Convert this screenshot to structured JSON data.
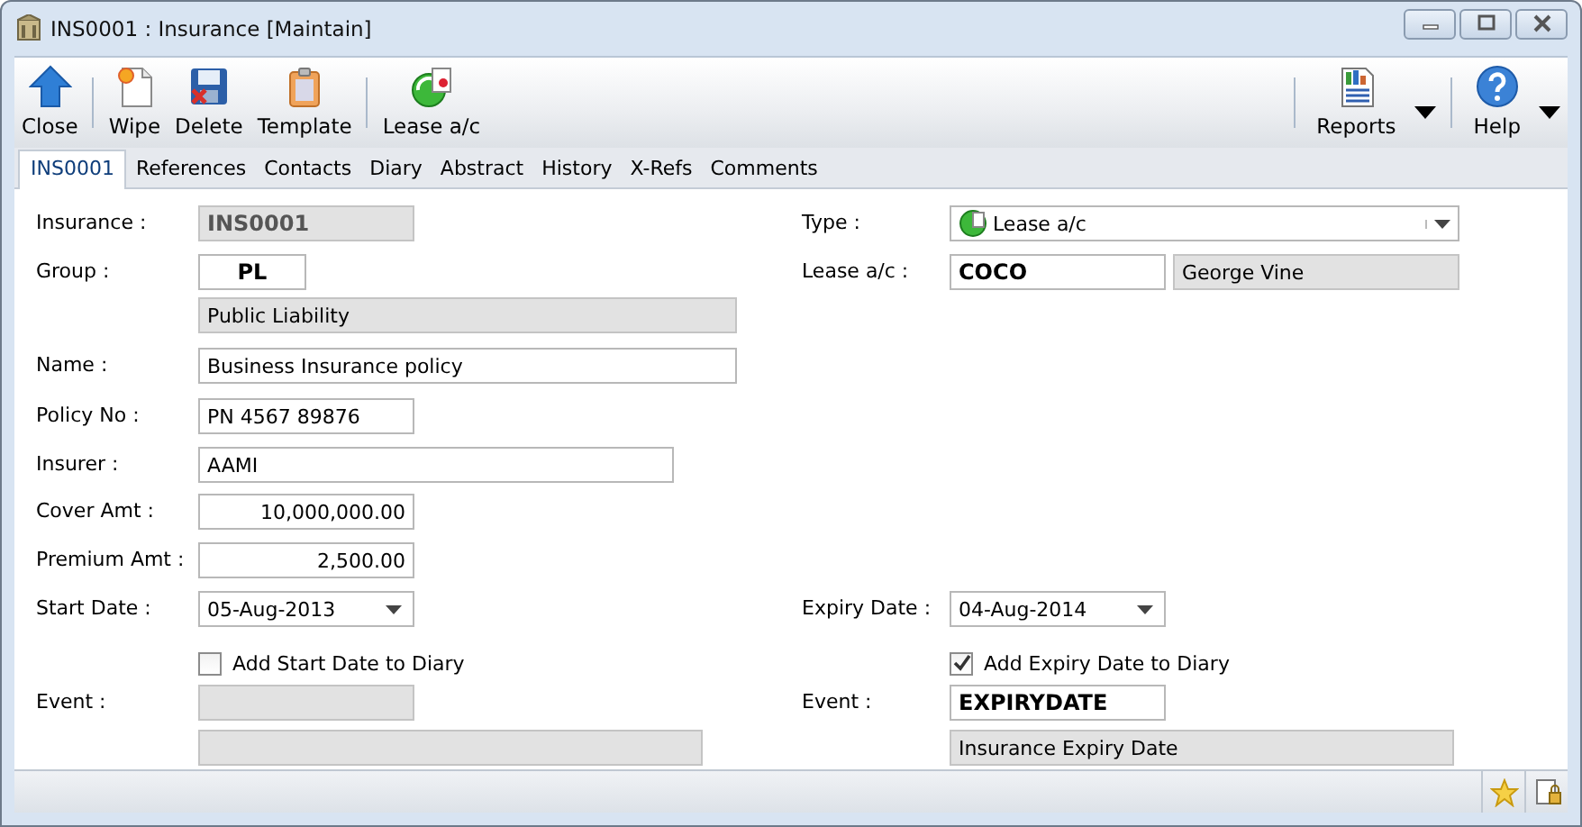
{
  "window": {
    "title": "INS0001 : Insurance [Maintain]"
  },
  "toolbar": {
    "left": [
      {
        "label": "Close",
        "kind": "close"
      },
      {
        "label": "Wipe",
        "kind": "wipe"
      },
      {
        "label": "Delete",
        "kind": "delete"
      },
      {
        "label": "Template",
        "kind": "template"
      },
      {
        "label": "Lease a/c",
        "kind": "lease"
      }
    ],
    "right": [
      {
        "label": "Reports",
        "kind": "reports"
      },
      {
        "label": "Help",
        "kind": "help"
      }
    ]
  },
  "tabs": [
    {
      "label": "INS0001",
      "selected": true
    },
    {
      "label": "References",
      "selected": false
    },
    {
      "label": "Contacts",
      "selected": false
    },
    {
      "label": "Diary",
      "selected": false
    },
    {
      "label": "Abstract",
      "selected": false
    },
    {
      "label": "History",
      "selected": false
    },
    {
      "label": "X-Refs",
      "selected": false
    },
    {
      "label": "Comments",
      "selected": false
    }
  ],
  "form": {
    "rows": [
      {
        "left": {
          "label": "Insurance :",
          "kind": "readonly-code",
          "value": "INS0001"
        },
        "right": {
          "label": "Type :",
          "kind": "type-dropdown",
          "value": "Lease a/c"
        }
      },
      {
        "left": {
          "label": "Group :",
          "kind": "code-center",
          "value": "PL"
        },
        "right": {
          "label": "Lease a/c :",
          "kind": "code",
          "value": "COCO",
          "extra": "George Vine"
        }
      },
      {
        "left": {
          "kind": "readonly",
          "value": "Public Liability"
        }
      },
      {
        "left": {
          "label": "Name :",
          "kind": "text",
          "value": "Business Insurance policy"
        }
      },
      {
        "left": {
          "label": "Policy No :",
          "kind": "text",
          "value": "PN 4567 89876"
        }
      },
      {
        "left": {
          "label": "Insurer :",
          "kind": "text",
          "value": "AAMI"
        }
      },
      {
        "left": {
          "label": "Cover Amt :",
          "kind": "amount",
          "value": "10,000,000.00"
        }
      },
      {
        "left": {
          "label": "Premium Amt :",
          "kind": "amount",
          "value": "2,500.00"
        }
      },
      {
        "left": {
          "label": "Start Date :",
          "kind": "dropdown",
          "value": "05-Aug-2013"
        },
        "right": {
          "label": "Expiry Date :",
          "kind": "dropdown",
          "value": "04-Aug-2014"
        }
      },
      {
        "left": {
          "kind": "checkbox",
          "label": "Add Start Date to Diary",
          "checked": false
        },
        "right": {
          "kind": "checkbox",
          "label": "Add Expiry Date to Diary",
          "checked": true
        }
      },
      {
        "left": {
          "label": "Event :",
          "kind": "readonly"
        },
        "right": {
          "label": "Event :",
          "kind": "code",
          "value": "EXPIRYDATE"
        }
      },
      {
        "left": {
          "kind": "readonly"
        },
        "right": {
          "kind": "readonly",
          "value": "Insurance Expiry Date"
        }
      }
    ]
  }
}
